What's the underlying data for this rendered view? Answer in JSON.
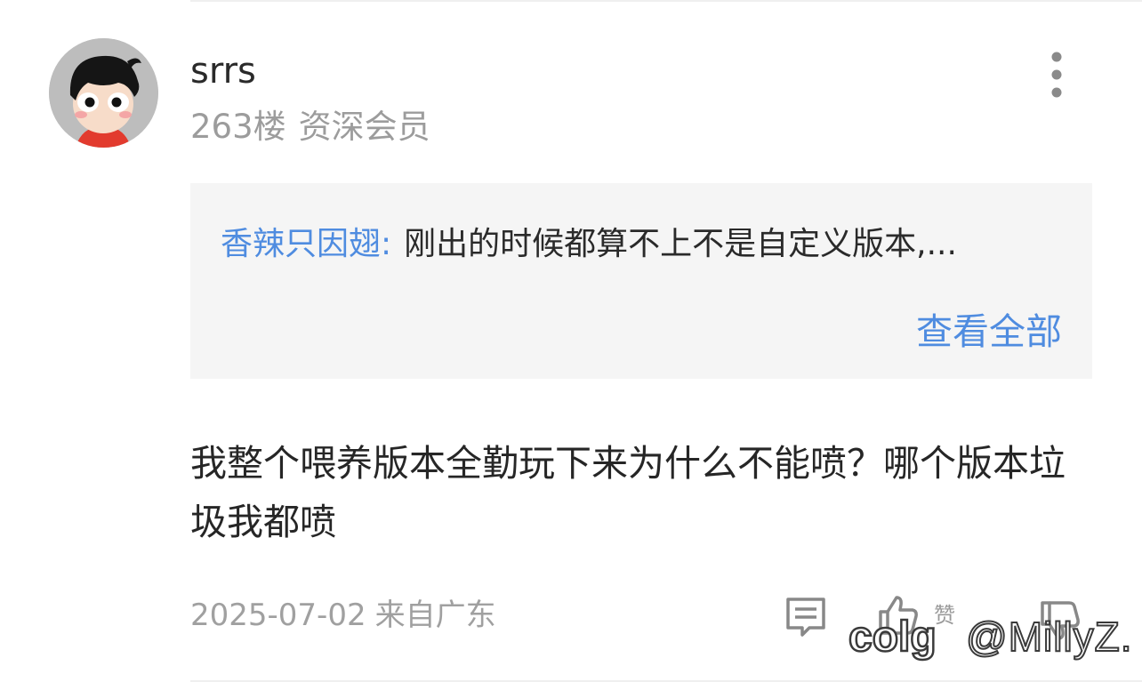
{
  "post": {
    "username": "srrs",
    "floor": "263楼",
    "rank": "资深会员",
    "quote": {
      "author": "香辣只因翅:",
      "text": "刚出的时候都算不上不是自定义版本,..."
    },
    "view_all_label": "查看全部",
    "body": "我整个喂养版本全勤玩下来为什么不能喷？哪个版本垃圾我都喷",
    "date": "2025-07-02",
    "location": "来自广东",
    "like_label": "赞"
  },
  "watermark": {
    "logo_text": "colg",
    "handle": "@MillyZ."
  },
  "icons": {
    "more": "more-vertical-icon",
    "comment": "comment-icon",
    "like": "thumbs-up-icon",
    "dislike": "thumbs-down-icon"
  },
  "colors": {
    "link": "#4f8ce0",
    "muted": "#9c9c9c",
    "text": "#262626",
    "quote_bg": "#f5f5f5"
  }
}
